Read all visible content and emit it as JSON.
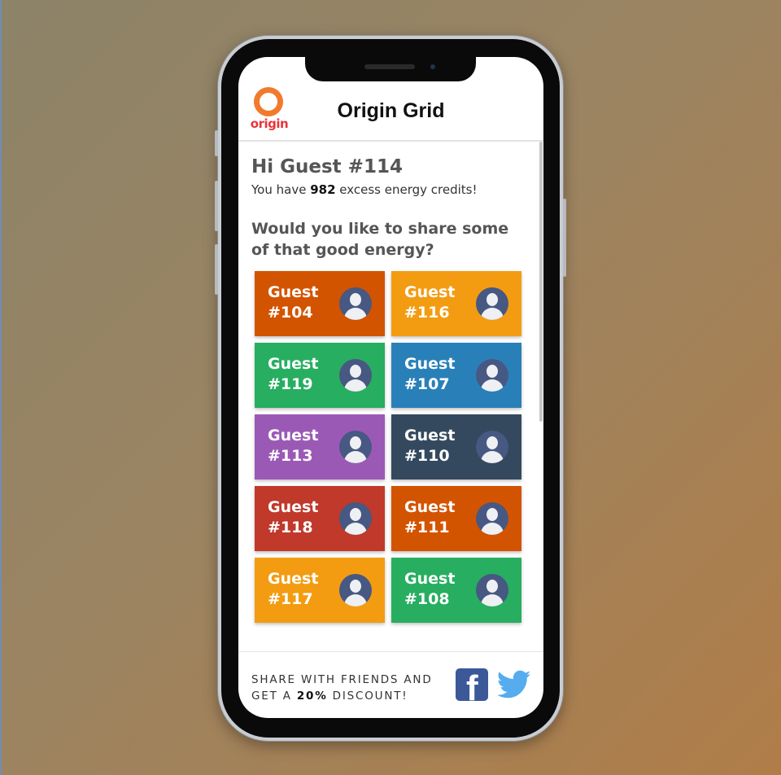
{
  "app": {
    "title": "Origin Grid",
    "logo_text": "origin"
  },
  "greeting": {
    "hello": "Hi Guest #114",
    "credits_prefix": "You have ",
    "credits_value": "982",
    "credits_suffix": " excess energy credits!"
  },
  "prompt": "Would you like to share some of that good energy?",
  "guests": [
    {
      "line1": "Guest",
      "line2": "#104",
      "color": "#d35400"
    },
    {
      "line1": "Guest",
      "line2": "#116",
      "color": "#f39c12"
    },
    {
      "line1": "Guest",
      "line2": "#119",
      "color": "#27ae60"
    },
    {
      "line1": "Guest",
      "line2": "#107",
      "color": "#2980b9"
    },
    {
      "line1": "Guest",
      "line2": "#113",
      "color": "#9b59b6"
    },
    {
      "line1": "Guest",
      "line2": "#110",
      "color": "#34495e"
    },
    {
      "line1": "Guest",
      "line2": "#118",
      "color": "#c0392b"
    },
    {
      "line1": "Guest",
      "line2": "#111",
      "color": "#d35400"
    },
    {
      "line1": "Guest",
      "line2": "#117",
      "color": "#f39c12"
    },
    {
      "line1": "Guest",
      "line2": "#108",
      "color": "#27ae60"
    }
  ],
  "footer": {
    "line1": "SHARE WITH FRIENDS AND",
    "line2_prefix": "GET A ",
    "line2_bold": "20%",
    "line2_suffix": " DISCOUNT!"
  },
  "icons": {
    "facebook": "facebook-icon",
    "twitter": "twitter-icon",
    "avatar": "user-avatar-icon"
  },
  "colors": {
    "facebook": "#3b5998",
    "twitter": "#55acee"
  }
}
